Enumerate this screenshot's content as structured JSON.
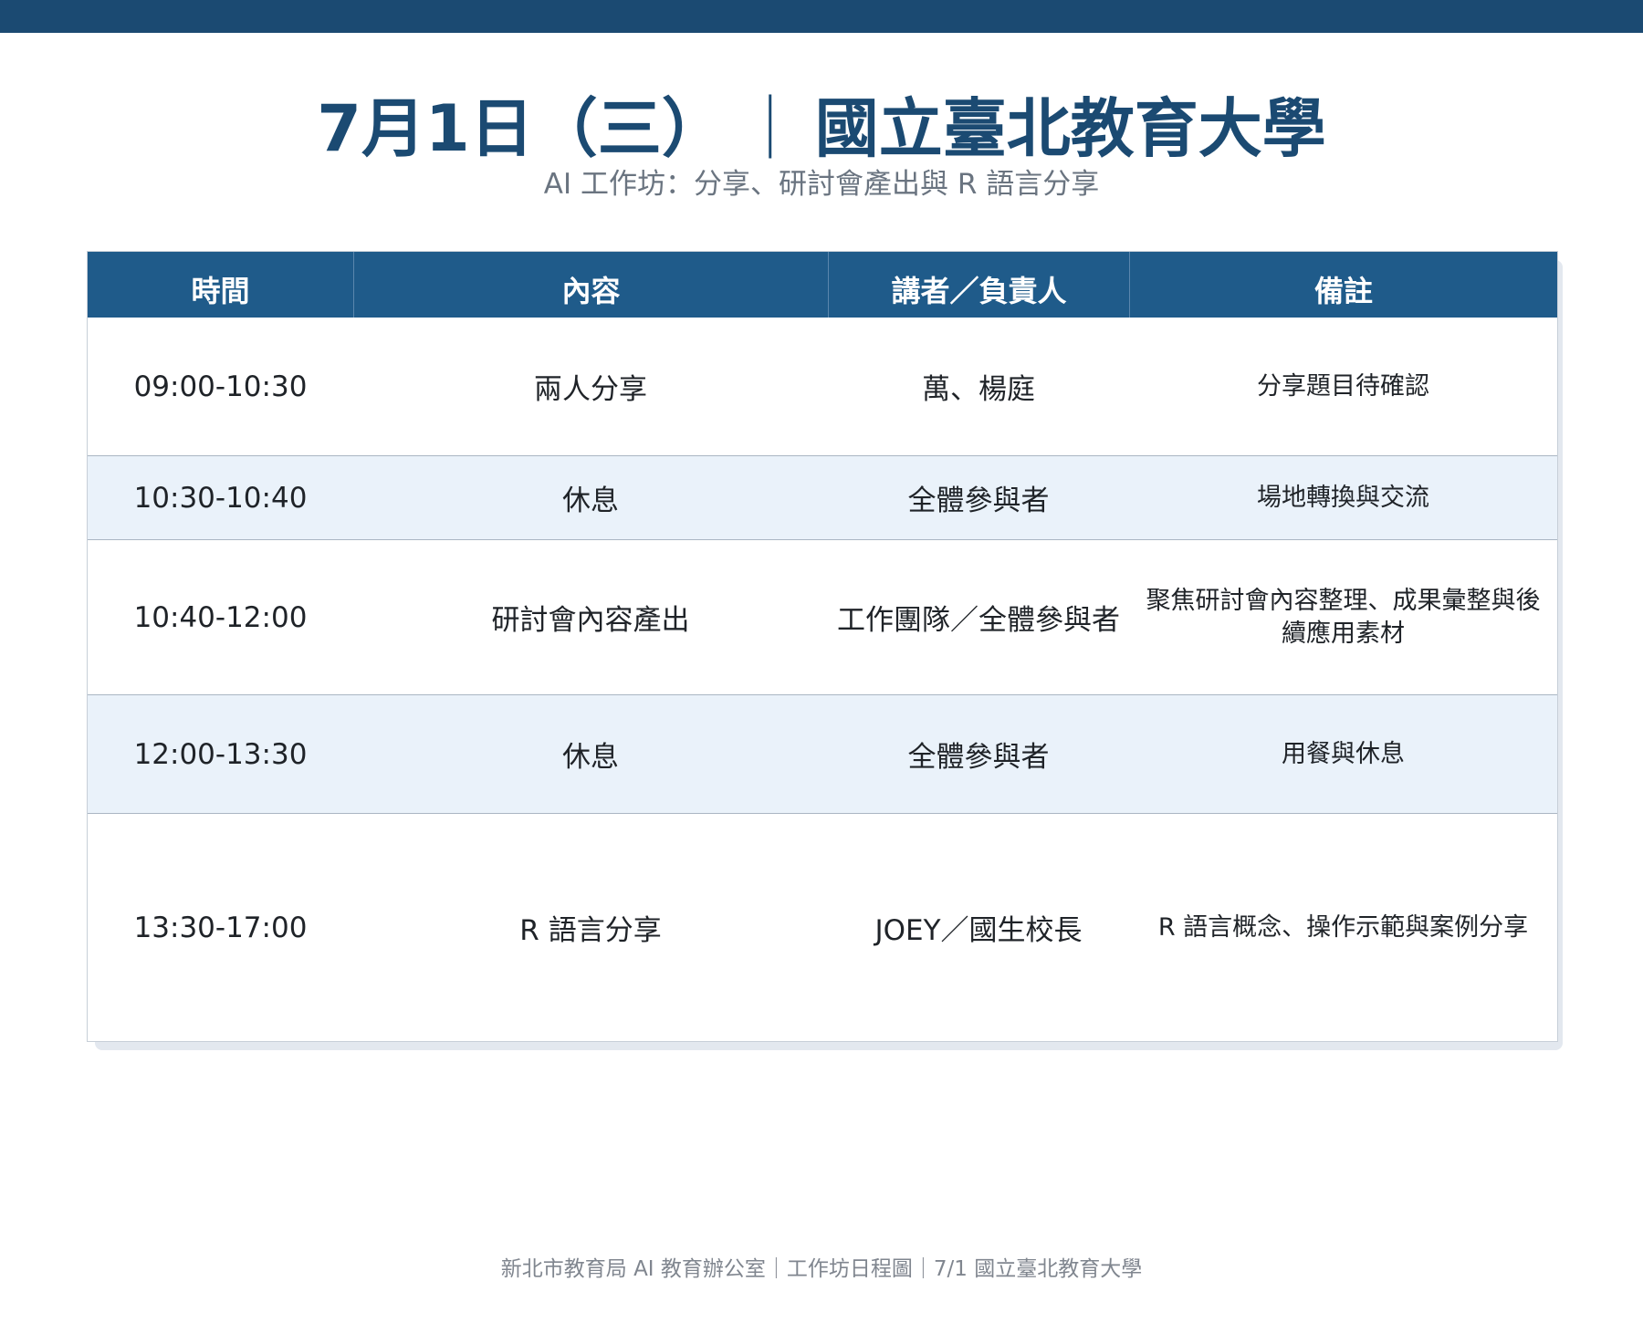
{
  "header": {
    "date": "7月1日（三）",
    "separator": "｜",
    "venue": "國立臺北教育大學",
    "subtitle": "AI 工作坊：分享、研討會產出與 R 語言分享"
  },
  "table": {
    "columns": [
      "時間",
      "內容",
      "講者／負責人",
      "備註"
    ],
    "rows": [
      {
        "time": "09:00-10:30",
        "content": "兩人分享",
        "speaker": "萬、楊庭",
        "note": "分享題目待確認"
      },
      {
        "time": "10:30-10:40",
        "content": "休息",
        "speaker": "全體參與者",
        "note": "場地轉換與交流"
      },
      {
        "time": "10:40-12:00",
        "content": "研討會內容產出",
        "speaker": "工作團隊／全體參與者",
        "note": "聚焦研討會內容整理、成果彙整與後續應用素材"
      },
      {
        "time": "12:00-13:30",
        "content": "休息",
        "speaker": "全體參與者",
        "note": "用餐與休息"
      },
      {
        "time": "13:30-17:00",
        "content": "R 語言分享",
        "speaker": "JOEY／國生校長",
        "note": "R 語言概念、操作示範與案例分享"
      }
    ]
  },
  "footer": {
    "text": "新北市教育局 AI 教育辦公室｜工作坊日程圖｜7/1 國立臺北教育大學"
  },
  "colors": {
    "brand": "#1b4a72",
    "header_bg": "#1f5b8a",
    "alt_row_bg": "#eaf2fa"
  }
}
